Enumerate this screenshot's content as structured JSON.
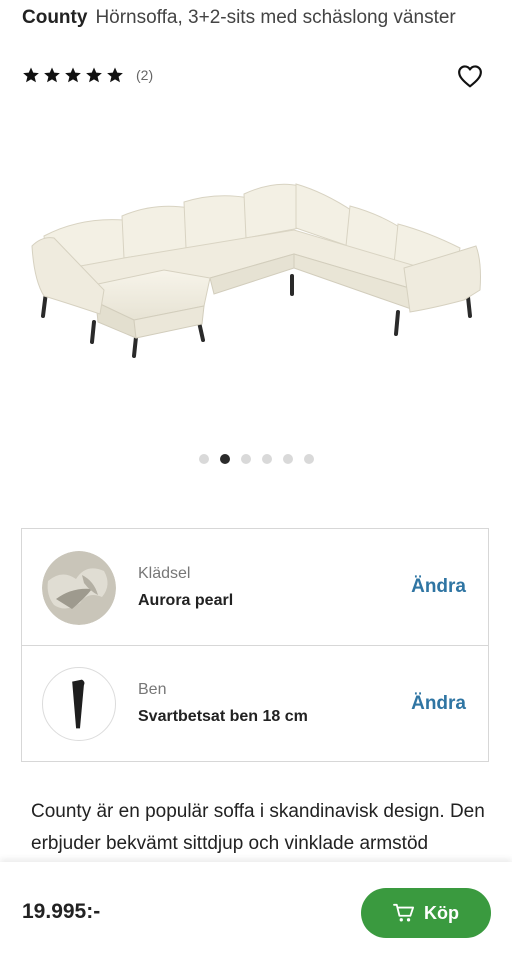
{
  "header": {
    "brand": "County",
    "product_name": "Hörnsoffa, 3+2-sits med schäslong vänster"
  },
  "rating": {
    "stars": 5,
    "count": "(2)"
  },
  "icons": {
    "favorite": "heart-icon",
    "cart": "cart-icon"
  },
  "carousel": {
    "total": 6,
    "active_index": 1
  },
  "options": [
    {
      "label": "Klädsel",
      "value": "Aurora pearl",
      "action": "Ändra"
    },
    {
      "label": "Ben",
      "value": "Svartbetsat ben 18 cm",
      "action": "Ändra"
    }
  ],
  "description": "County är en populär soffa i skandinavisk design. Den erbjuder bekvämt sittdjup och vinklade armstöd",
  "purchase": {
    "price": "19.995:-",
    "buy_label": "Köp"
  },
  "colors": {
    "accent_link": "#2f75a3",
    "buy_button": "#3a9a3f"
  }
}
